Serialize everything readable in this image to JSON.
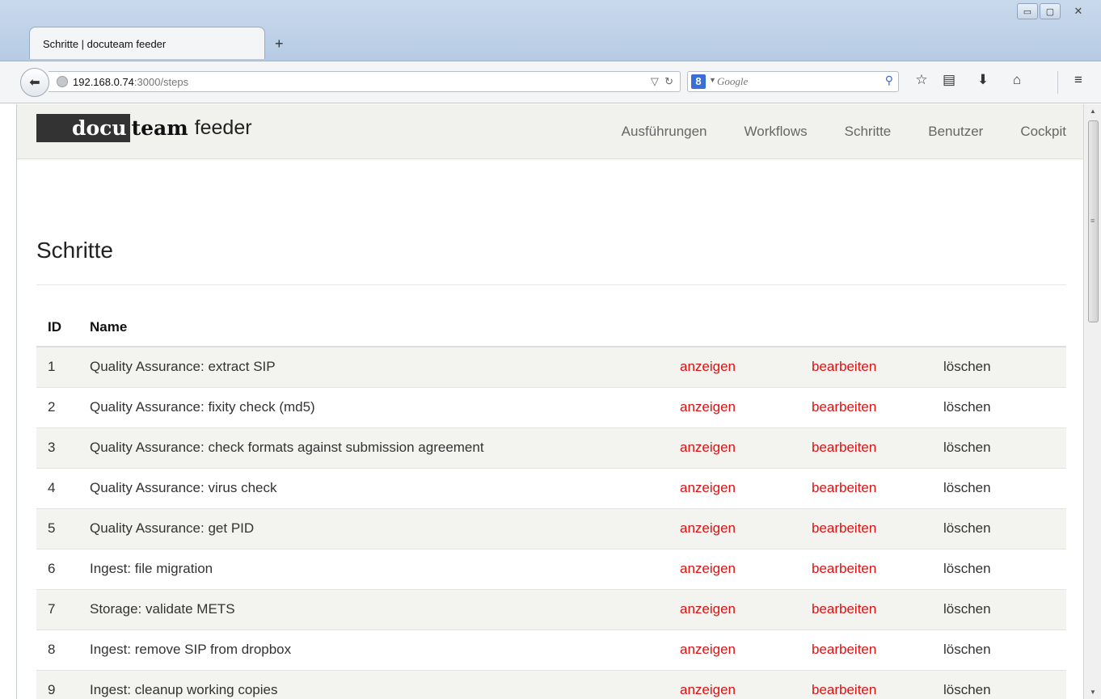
{
  "browser": {
    "tab_title": "Schritte | docuteam feeder",
    "new_tab": "+",
    "url_host": "192.168.0.74",
    "url_path": ":3000/steps",
    "search_placeholder": "Google",
    "window_controls": {
      "minimize": "▭",
      "maximize": "▢",
      "close": "✕"
    }
  },
  "site": {
    "brand_docu": "docu",
    "brand_team": "team",
    "brand_feeder": "feeder",
    "nav": [
      "Ausführungen",
      "Workflows",
      "Schritte",
      "Benutzer",
      "Cockpit"
    ]
  },
  "page": {
    "title": "Schritte",
    "columns": {
      "id": "ID",
      "name": "Name"
    },
    "rows": [
      {
        "id": "1",
        "name": "Quality Assurance: extract SIP",
        "show": "anzeigen",
        "edit": "bearbeiten",
        "delete": "löschen"
      },
      {
        "id": "2",
        "name": "Quality Assurance: fixity check (md5)",
        "show": "anzeigen",
        "edit": "bearbeiten",
        "delete": "löschen"
      },
      {
        "id": "3",
        "name": "Quality Assurance: check formats against submission agreement",
        "show": "anzeigen",
        "edit": "bearbeiten",
        "delete": "löschen"
      },
      {
        "id": "4",
        "name": "Quality Assurance: virus check",
        "show": "anzeigen",
        "edit": "bearbeiten",
        "delete": "löschen"
      },
      {
        "id": "5",
        "name": "Quality Assurance: get PID",
        "show": "anzeigen",
        "edit": "bearbeiten",
        "delete": "löschen"
      },
      {
        "id": "6",
        "name": "Ingest: file migration",
        "show": "anzeigen",
        "edit": "bearbeiten",
        "delete": "löschen"
      },
      {
        "id": "7",
        "name": "Storage: validate METS",
        "show": "anzeigen",
        "edit": "bearbeiten",
        "delete": "löschen"
      },
      {
        "id": "8",
        "name": "Ingest: remove SIP from dropbox",
        "show": "anzeigen",
        "edit": "bearbeiten",
        "delete": "löschen"
      },
      {
        "id": "9",
        "name": "Ingest: cleanup working copies",
        "show": "anzeigen",
        "edit": "bearbeiten",
        "delete": "löschen"
      }
    ]
  },
  "colors": {
    "link_red": "#e01010",
    "stripe": "#f3f3f0",
    "header_bg": "#f1f1ee",
    "brand_dark": "#333333"
  }
}
